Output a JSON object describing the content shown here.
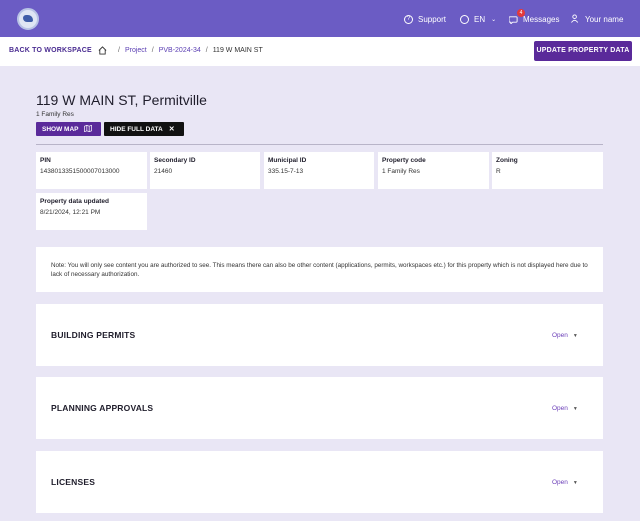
{
  "topbar": {
    "support_label": "Support",
    "language_label": "EN",
    "messages_label": "Messages",
    "messages_badge": "4",
    "user_label": "Your name"
  },
  "subnav": {
    "back_label": "BACK TO WORKSPACE",
    "breadcrumbs": [
      "Project",
      "PVB-2024-34",
      "119 W MAIN ST"
    ],
    "update_button": "UPDATE PROPERTY DATA"
  },
  "property": {
    "title": "119 W MAIN ST, Permitville",
    "subtitle": "1 Family Res",
    "show_map_label": "SHOW MAP",
    "hide_data_label": "HIDE FULL DATA"
  },
  "fields": [
    {
      "label": "PIN",
      "value": "1438013351500007013000"
    },
    {
      "label": "Secondary ID",
      "value": "21460"
    },
    {
      "label": "Municipal ID",
      "value": "335.15-7-13"
    },
    {
      "label": "Property code",
      "value": "1 Family Res"
    },
    {
      "label": "Zoning",
      "value": "R"
    },
    {
      "label": "Property data updated",
      "value": "8/21/2024, 12:21 PM"
    }
  ],
  "note": "Note: You will only see content you are authorized to see. This means there can also be other content (applications, permits, workspaces etc.) for this property which is not displayed here due to lack of necessary authorization.",
  "sections": [
    {
      "title": "BUILDING PERMITS",
      "action": "Open"
    },
    {
      "title": "PLANNING APPROVALS",
      "action": "Open"
    },
    {
      "title": "LICENSES",
      "action": "Open"
    }
  ],
  "colors": {
    "topbar": "#6b5cc4",
    "primary": "#5a2a9a",
    "background": "#e9e6f5"
  }
}
